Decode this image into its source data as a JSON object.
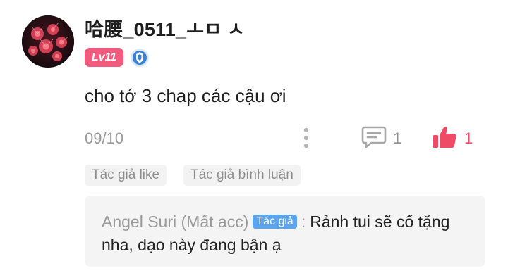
{
  "comment": {
    "username": "哈腰_0511_ㅗㅁ ㅅ",
    "level": "Lv11",
    "text": "cho tớ 3 chap các cậu ơi",
    "date": "09/10",
    "reply_count": "1",
    "like_count": "1"
  },
  "tags": {
    "author_liked": "Tác giả like",
    "author_replied": "Tác giả bình luận"
  },
  "reply": {
    "author": "Angel Suri (Mất acc)",
    "author_badge": "Tác giả",
    "colon": ":",
    "text_line1": "Rảnh tui sẽ cố tặng",
    "text_line2": "nha, dạo này đang bận ạ"
  },
  "colors": {
    "level_badge": "#f25b7d",
    "like_accent": "#ef4a66",
    "author_badge": "#5aa5f0",
    "verify_badge": "#3b82d6"
  },
  "icons": {
    "verify": "verified-shield-icon",
    "more": "more-vertical-icon",
    "reply": "comment-bubble-icon",
    "like": "thumbs-up-icon"
  }
}
